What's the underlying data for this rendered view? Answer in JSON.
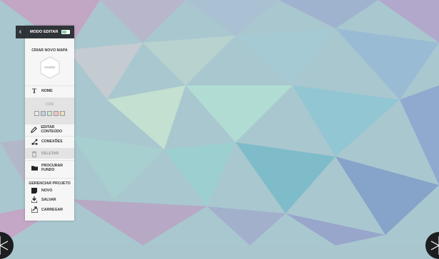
{
  "panel": {
    "mode_label": "MODO EDITAR",
    "toggle_on": true,
    "create_title": "CRIAR NOVO MAPA",
    "drag_hint": "Arrasta!",
    "items": {
      "nome": "NOME",
      "cor": "COR",
      "editar": "EDITAR CONTEÚDO",
      "conexoes": "CONEXÕES",
      "deletar": "DELETAR",
      "procurar": "PROCURAR FUNDO"
    },
    "swatch_colors": [
      "#e8ebee",
      "#bcd3e6",
      "#cde6cf",
      "#f0c4c6",
      "#f2dcc0"
    ],
    "project_title": "GERENCIAR PROJETO",
    "project": {
      "novo": "NOVO",
      "salvar": "SALVAR",
      "carregar": "CARREGAR"
    }
  }
}
